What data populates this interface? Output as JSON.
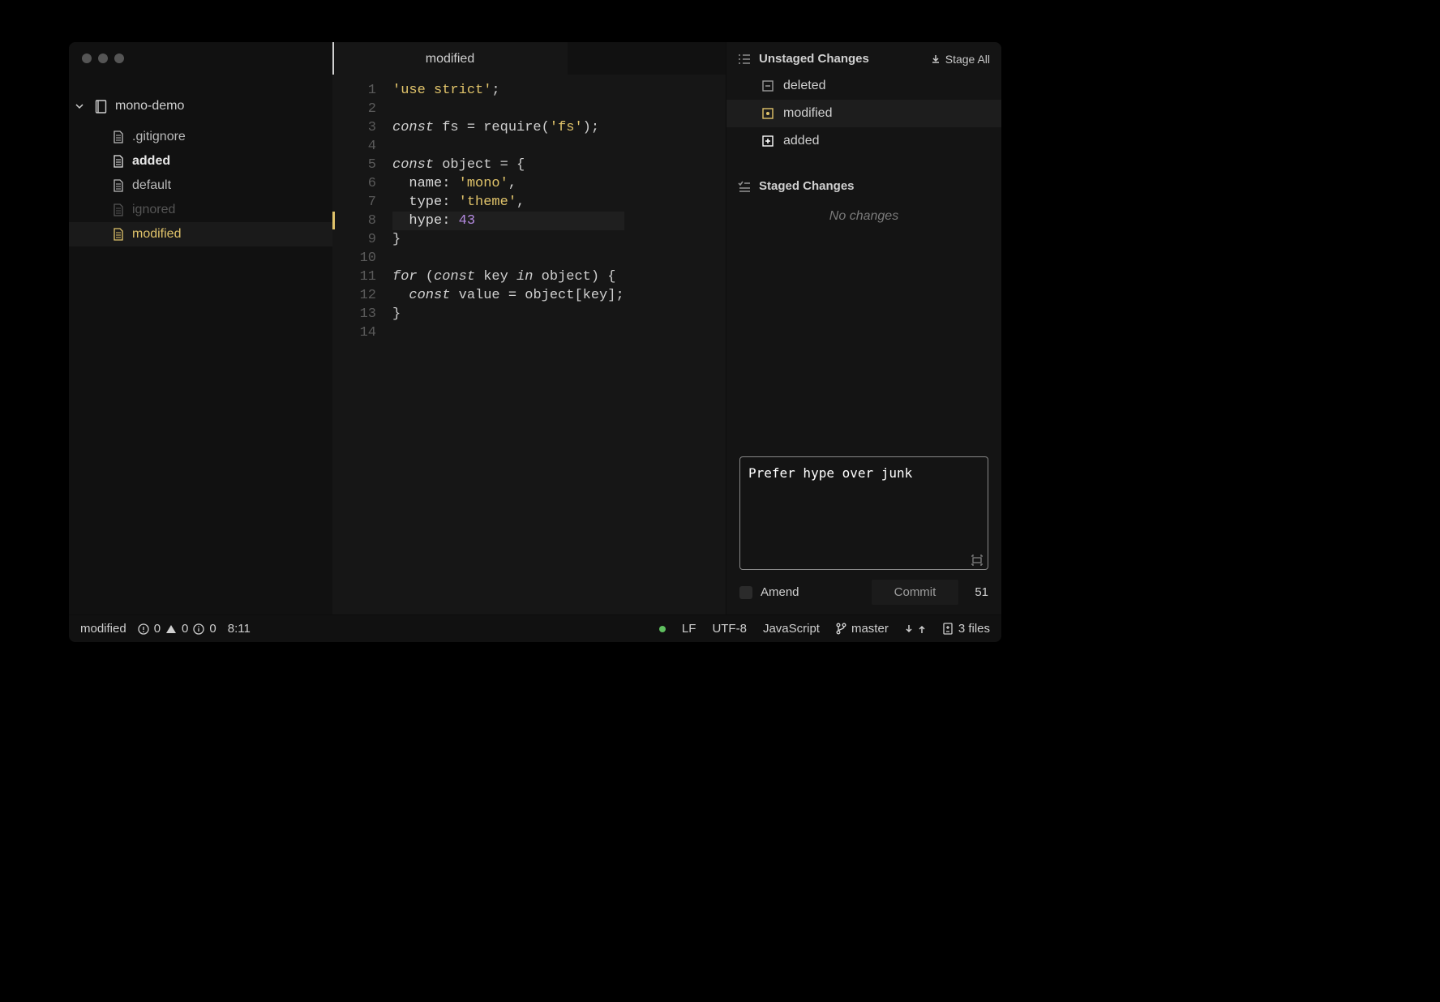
{
  "project": {
    "name": "mono-demo",
    "files": [
      {
        "name": ".gitignore",
        "style": "normal"
      },
      {
        "name": "added",
        "style": "bold"
      },
      {
        "name": "default",
        "style": "normal"
      },
      {
        "name": "ignored",
        "style": "dim"
      },
      {
        "name": "modified",
        "style": "active"
      }
    ]
  },
  "editor": {
    "tab": "modified",
    "code_html": [
      "<span class='tok-str'>'use strict'</span>;",
      "",
      "<span class='tok-kw'>const</span> fs = require(<span class='tok-str'>'fs'</span>);",
      "",
      "<span class='tok-kw'>const</span> object = {",
      "  <span class='tok-prop'>name:</span> <span class='tok-str'>'mono'</span>,",
      "  <span class='tok-prop'>type:</span> <span class='tok-str'>'theme'</span>,",
      "  <span class='tok-prop'>hype:</span> <span class='tok-num'>43</span>",
      "}",
      "",
      "<span class='tok-kw'>for</span> (<span class='tok-kw'>const</span> key <span class='tok-kw'>in</span> object) {",
      "  <span class='tok-kw'>const</span> value = object[key];",
      "}",
      ""
    ],
    "modified_lines": [
      8
    ],
    "line_count": 14
  },
  "git": {
    "unstaged": {
      "title": "Unstaged Changes",
      "stage_all": "Stage All",
      "items": [
        {
          "name": "deleted",
          "kind": "deleted",
          "active": false
        },
        {
          "name": "modified",
          "kind": "modified",
          "active": true
        },
        {
          "name": "added",
          "kind": "added",
          "active": false
        }
      ]
    },
    "staged": {
      "title": "Staged Changes",
      "empty": "No changes"
    },
    "commit": {
      "message": "Prefer hype over junk",
      "amend_label": "Amend",
      "commit_label": "Commit",
      "count": "51"
    }
  },
  "status": {
    "filename": "modified",
    "errors": "0",
    "warnings": "0",
    "info": "0",
    "cursor": "8:11",
    "eol": "LF",
    "encoding": "UTF-8",
    "grammar": "JavaScript",
    "branch": "master",
    "files": "3 files"
  }
}
